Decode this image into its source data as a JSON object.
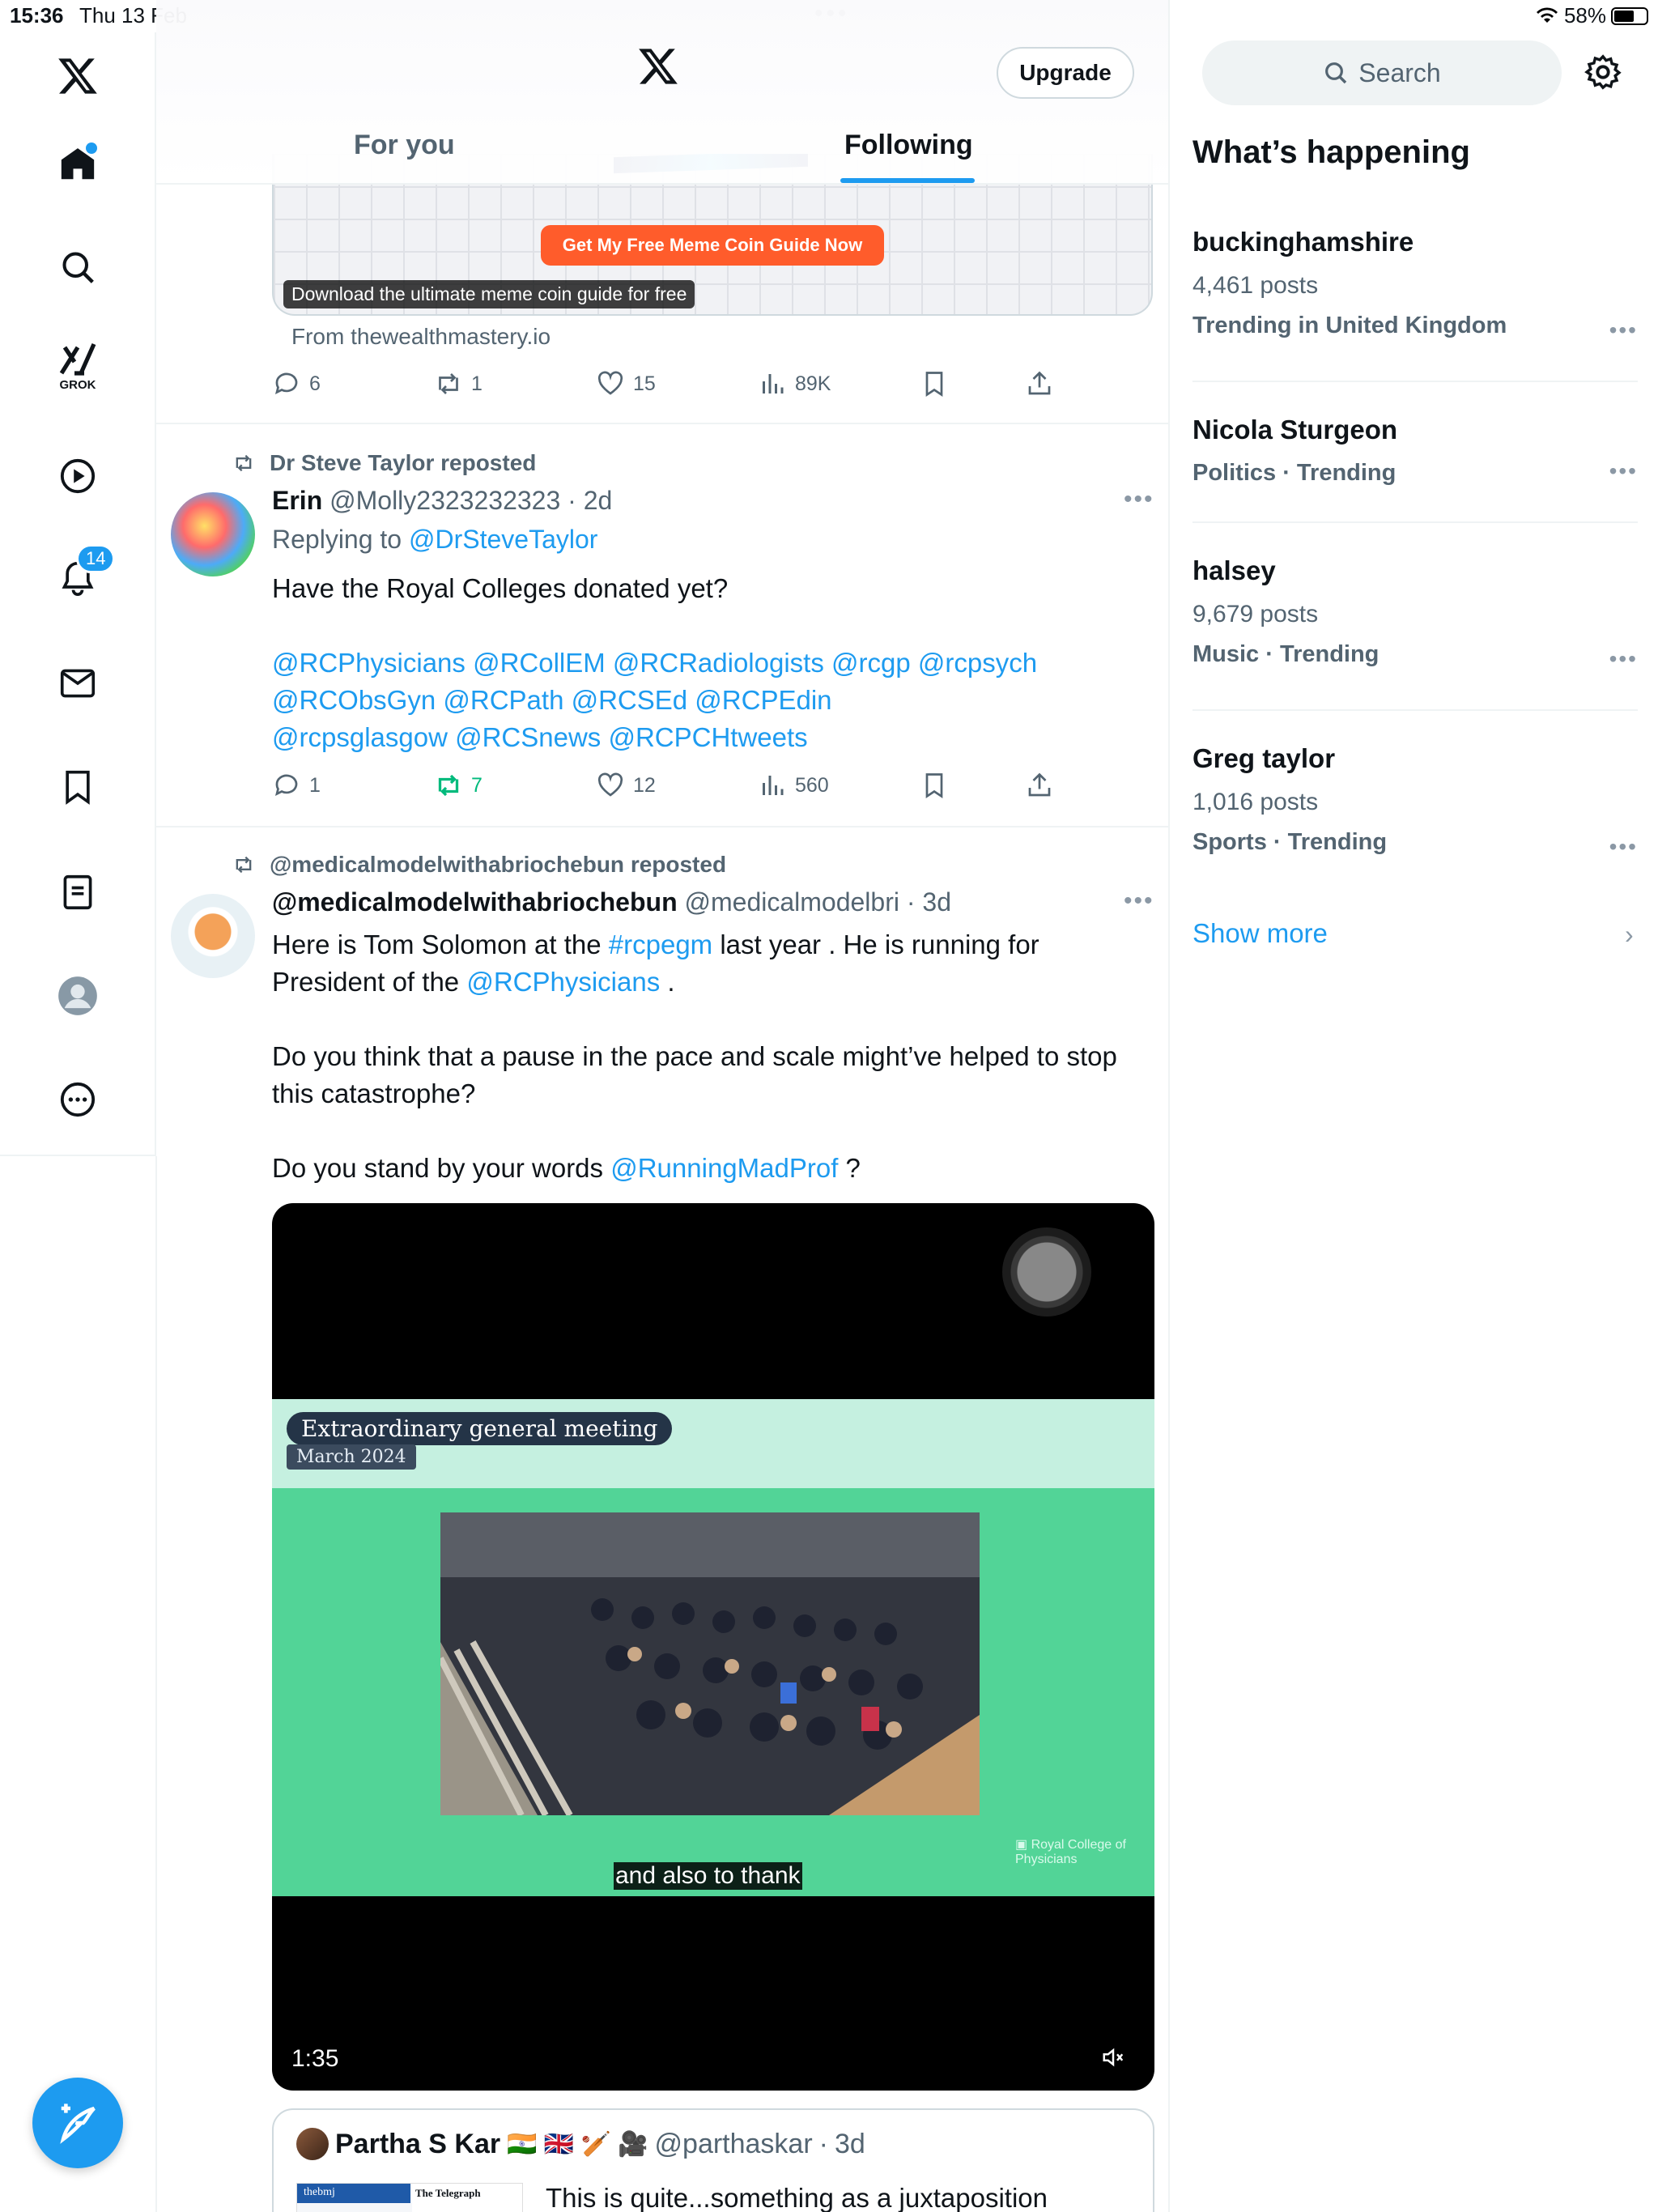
{
  "status_bar": {
    "time": "15:36",
    "date": "Thu 13 Feb",
    "battery": "58%"
  },
  "left_nav": {
    "notification_count": "14",
    "grok_label": "GROK"
  },
  "header": {
    "upgrade_label": "Upgrade",
    "tabs": [
      "For you",
      "Following"
    ],
    "active_tab": "Following"
  },
  "ad": {
    "cta": "Get My Free Meme Coin Guide Now",
    "caption": "Download the ultimate meme coin guide for free",
    "from": "From thewealthmastery.io",
    "stats": {
      "replies": "6",
      "reposts": "1",
      "likes": "15",
      "views": "89K"
    }
  },
  "tweet1": {
    "repost_by": "Dr Steve Taylor reposted",
    "name": "Erin",
    "handle": "@Molly2323232323",
    "time": "2d",
    "replying_prefix": "Replying to",
    "replying_to": "@DrSteveTaylor",
    "text": "Have the Royal Colleges donated yet?",
    "mentions_line1": "@RCPhysicians @RCollEM @RCRadiologists @rcgp @rcpsych",
    "mentions_line2": "@RCObsGyn @RCPath @RCSEd @RCPEdin",
    "mentions_line3": "@rcpsglasgow @RCSnews @RCPCHtweets",
    "stats": {
      "replies": "1",
      "reposts": "7",
      "likes": "12",
      "views": "560"
    }
  },
  "tweet2": {
    "repost_by": "@medicalmodelwithabriochebun reposted",
    "name": "@medicalmodelwithabriochebun",
    "handle": "@medicalmodelbri",
    "time": "3d",
    "p1_a": "Here is Tom Solomon at the ",
    "p1_tag": "#rcpegm",
    "p1_b": " last year . He is running for",
    "p1_c": "President of the ",
    "p1_mention": "@RCPhysicians",
    "p1_d": " .",
    "p2": "Do you think that a pause in the pace and scale might’ve helped to stop this catastrophe?",
    "p3_a": "Do you stand by your words ",
    "p3_mention": "@RunningMadProf",
    "p3_b": " ?",
    "video": {
      "title": "Extraordinary general meeting",
      "subtitle": "March 2024",
      "caption": "and also to thank",
      "logo": "Royal College of Physicians",
      "duration": "1:35"
    }
  },
  "quote": {
    "name": "Partha S Kar",
    "flags": "🇮🇳 🇬🇧 🏏 🎥",
    "handle": "@parthaskar",
    "time": "3d",
    "text": "This is quite...something as a juxtaposition",
    "thumb_left": "thebmj",
    "thumb_right": "The Telegraph"
  },
  "sidebar": {
    "search_placeholder": "Search",
    "title": "What’s happening",
    "trends": [
      {
        "name": "buckinghamshire",
        "posts": "4,461 posts",
        "category": "Trending in United Kingdom"
      },
      {
        "name": "Nicola Sturgeon",
        "posts": "",
        "category": "Politics · Trending"
      },
      {
        "name": "halsey",
        "posts": "9,679 posts",
        "category": "Music · Trending"
      },
      {
        "name": "Greg taylor",
        "posts": "1,016 posts",
        "category": "Sports · Trending"
      }
    ],
    "show_more": "Show more"
  },
  "colors": {
    "accent": "#1d9bf0",
    "repost_green": "#00ba7c",
    "muted": "#536471",
    "ad_cta": "#ff5c2b",
    "video_green": "#52d497"
  }
}
